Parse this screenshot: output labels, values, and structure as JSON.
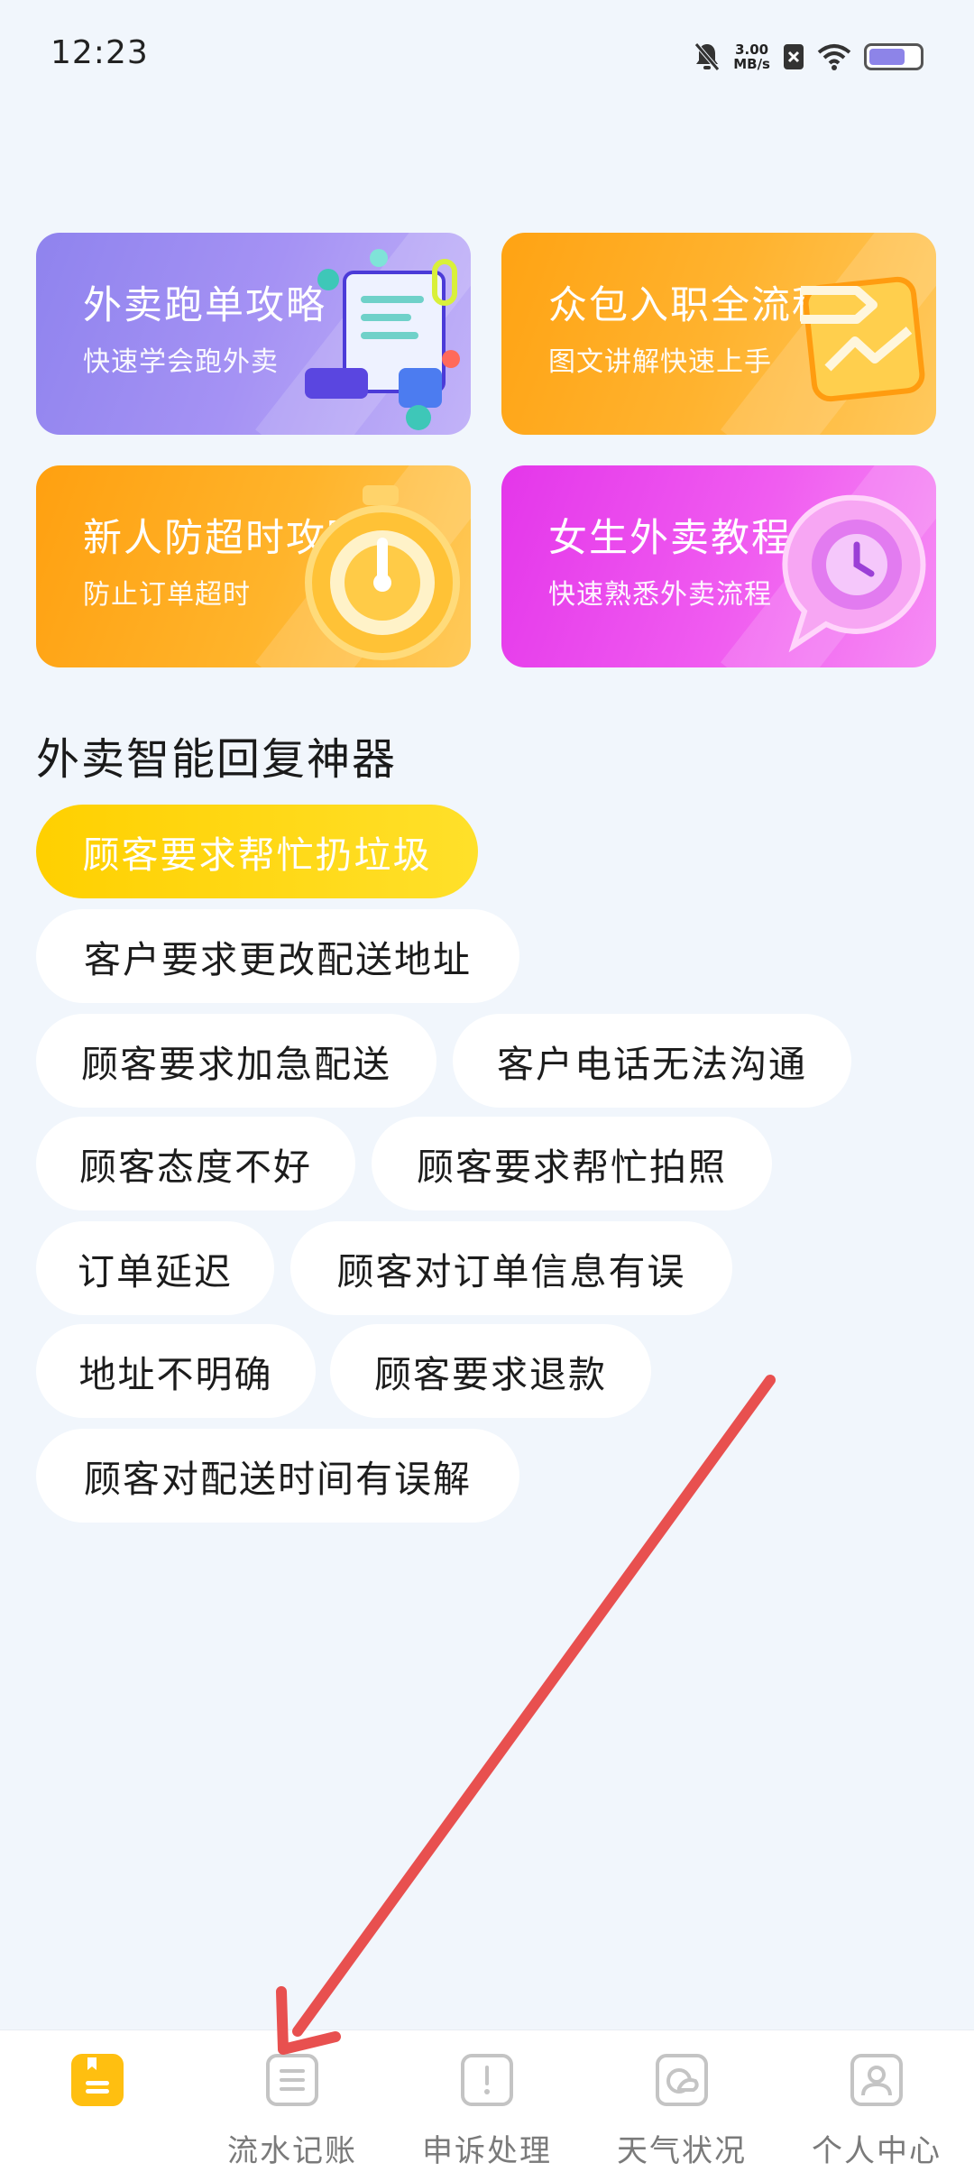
{
  "status_bar": {
    "time": "12:23",
    "net_speed_value": "3.00",
    "net_speed_unit": "MB/s",
    "icons": [
      "mute-bell-icon",
      "no-sim-icon",
      "wifi-icon",
      "battery-icon"
    ],
    "battery_level": 0.75
  },
  "cards": [
    {
      "title": "外卖跑单攻略",
      "subtitle": "快速学会跑外卖",
      "icon": "document-3d-icon",
      "color": "#9a8cf0"
    },
    {
      "title": "众包入职全流程",
      "subtitle": "图文讲解快速上手",
      "icon": "chart-card-3d-icon",
      "color": "#ffaa20"
    },
    {
      "title": "新人防超时攻略",
      "subtitle": "防止订单超时",
      "icon": "stopwatch-3d-icon",
      "color": "#ffaa20"
    },
    {
      "title": "女生外卖教程",
      "subtitle": "快速熟悉外卖流程",
      "icon": "clock-bubble-3d-icon",
      "color": "#ec4ded"
    }
  ],
  "section": {
    "title": "外卖智能回复神器"
  },
  "chips": [
    {
      "label": "顾客要求帮忙扔垃圾",
      "selected": true
    },
    {
      "label": "客户要求更改配送地址",
      "selected": false
    },
    {
      "label": "顾客要求加急配送",
      "selected": false
    },
    {
      "label": "客户电话无法沟通",
      "selected": false
    },
    {
      "label": "顾客态度不好",
      "selected": false
    },
    {
      "label": "顾客要求帮忙拍照",
      "selected": false
    },
    {
      "label": "订单延迟",
      "selected": false
    },
    {
      "label": "顾客对订单信息有误",
      "selected": false
    },
    {
      "label": "地址不明确",
      "selected": false
    },
    {
      "label": "顾客要求退款",
      "selected": false
    },
    {
      "label": "顾客对配送时间有误解",
      "selected": false
    }
  ],
  "bottom_nav": {
    "items": [
      {
        "label": "",
        "icon": "bookmark-home-icon",
        "active": true
      },
      {
        "label": "流水记账",
        "icon": "list-icon",
        "active": false
      },
      {
        "label": "申诉处理",
        "icon": "exclamation-icon",
        "active": false
      },
      {
        "label": "天气状况",
        "icon": "weather-icon",
        "active": false
      },
      {
        "label": "个人中心",
        "icon": "person-icon",
        "active": false
      }
    ]
  },
  "colors": {
    "background": "#f1f6fc",
    "accent_yellow": "#ffd000",
    "nav_active": "#ffbf10",
    "annotation_arrow": "#e8504f"
  }
}
